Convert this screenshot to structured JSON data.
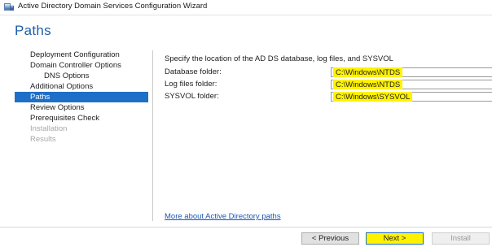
{
  "window": {
    "title": "Active Directory Domain Services Configuration Wizard",
    "icon": "server-role-icon"
  },
  "page": {
    "title": "Paths"
  },
  "nav": {
    "items": [
      {
        "label": "Deployment Configuration",
        "state": "normal"
      },
      {
        "label": "Domain Controller Options",
        "state": "normal"
      },
      {
        "label": "DNS Options",
        "state": "normal",
        "indent": true
      },
      {
        "label": "Additional Options",
        "state": "normal"
      },
      {
        "label": "Paths",
        "state": "selected"
      },
      {
        "label": "Review Options",
        "state": "normal"
      },
      {
        "label": "Prerequisites Check",
        "state": "normal"
      },
      {
        "label": "Installation",
        "state": "disabled"
      },
      {
        "label": "Results",
        "state": "disabled"
      }
    ]
  },
  "content": {
    "intro": "Specify the location of the AD DS database, log files, and SYSVOL",
    "fields": [
      {
        "label": "Database folder:",
        "value": "C:\\Windows\\NTDS"
      },
      {
        "label": "Log files folder:",
        "value": "C:\\Windows\\NTDS"
      },
      {
        "label": "SYSVOL folder:",
        "value": "C:\\Windows\\SYSVOL"
      }
    ],
    "help_link": "More about Active Directory paths"
  },
  "buttons": {
    "previous": "< Previous",
    "next": "Next >",
    "install": "Install"
  },
  "colors": {
    "accent": "#1e6fc7",
    "highlight": "#fff200",
    "title": "#1e5ea8"
  }
}
